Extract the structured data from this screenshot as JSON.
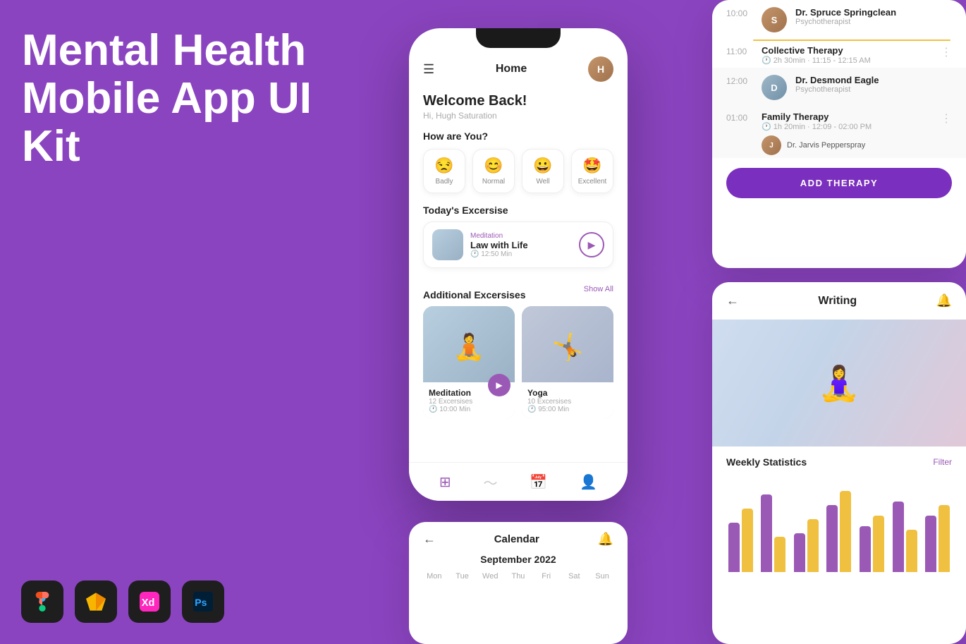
{
  "hero": {
    "title_line1": "Mental Health",
    "title_line2": "Mobile App UI Kit"
  },
  "phone": {
    "header_title": "Home",
    "welcome": "Welcome Back!",
    "sub": "Hi, Hugh Saturation",
    "how_are_you": "How are You?",
    "moods": [
      {
        "emoji": "😒",
        "label": "Badly"
      },
      {
        "emoji": "😊",
        "label": "Normal"
      },
      {
        "emoji": "😀",
        "label": "Well"
      },
      {
        "emoji": "🤩",
        "label": "Excellent"
      }
    ],
    "today_exercise_title": "Today's Excersise",
    "exercise": {
      "tag": "Meditation",
      "name": "Law with Life",
      "time": "12:50 Min"
    },
    "additional_title": "Additional Excersises",
    "show_all": "Show All",
    "additional_exercises": [
      {
        "name": "Meditation",
        "sub1": "12 Excersises",
        "sub2": "10:00 Min"
      },
      {
        "name": "Yoga",
        "sub1": "10 Excersises",
        "sub2": "95:00 Min"
      }
    ]
  },
  "schedule": {
    "times": [
      "10:00",
      "11:00",
      "12:00",
      "01:00"
    ],
    "items": [
      {
        "time": "10:00",
        "name": "Dr. Spruce Springclean",
        "role": "Psychotherapist"
      },
      {
        "time": "11:00",
        "name": "Collective Therapy",
        "detail": "2h 30min · 11:15 - 12:15 AM"
      },
      {
        "time": "12:00",
        "name": "Dr. Desmond Eagle",
        "role": "Psychotherapist"
      },
      {
        "time": "01:00",
        "name": "Family Therapy",
        "detail": "1h 20min · 12:09 - 02:00 PM",
        "doctor": "Dr. Jarvis Pepperspray"
      }
    ],
    "add_therapy_label": "ADD THERAPY"
  },
  "writing_panel": {
    "title": "Writing",
    "stats_title": "Weekly Statistics",
    "filter_label": "Filter",
    "bars": [
      {
        "purple": 70,
        "yellow": 90
      },
      {
        "purple": 110,
        "yellow": 50
      },
      {
        "purple": 55,
        "yellow": 75
      },
      {
        "purple": 95,
        "yellow": 115
      },
      {
        "purple": 65,
        "yellow": 80
      },
      {
        "purple": 100,
        "yellow": 60
      },
      {
        "purple": 80,
        "yellow": 95
      }
    ]
  },
  "calendar": {
    "title": "Calendar",
    "month": "September 2022",
    "days": [
      "Mon",
      "Tue",
      "Wed",
      "Thu",
      "Fri",
      "Sat",
      "Sun"
    ]
  },
  "tools": [
    "Figma",
    "Sketch",
    "XD",
    "Photoshop"
  ]
}
